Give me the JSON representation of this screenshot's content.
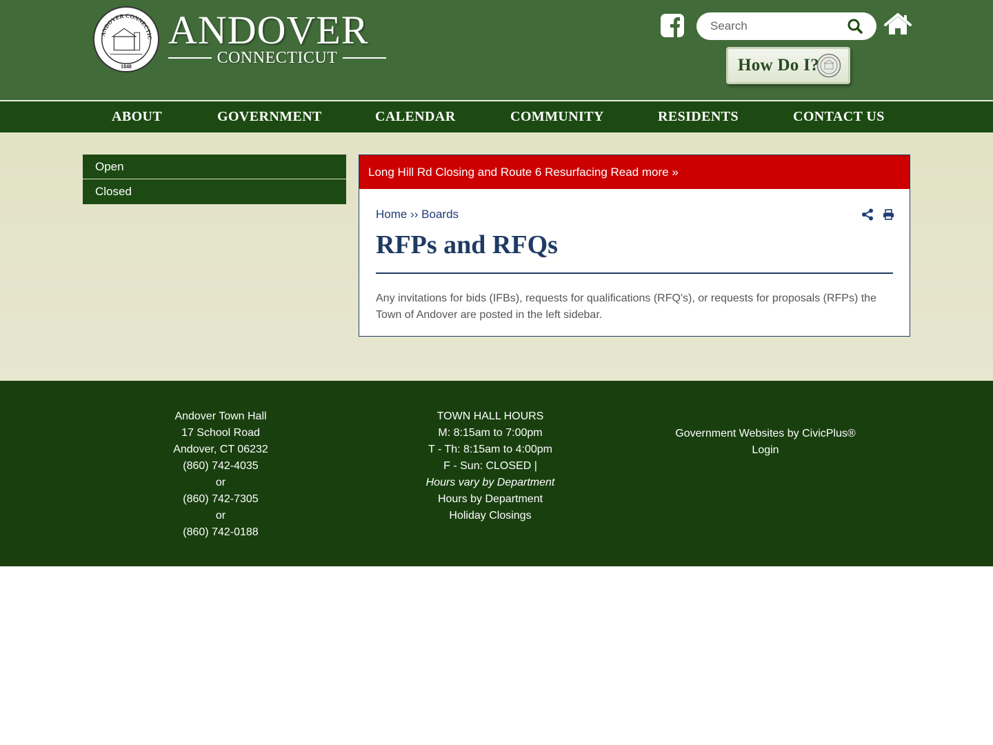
{
  "header": {
    "site_title": "ANDOVER",
    "site_subtitle": "CONNECTICUT",
    "search_placeholder": "Search",
    "how_do_i_label": "How Do I?"
  },
  "nav": {
    "items": [
      "ABOUT",
      "GOVERNMENT",
      "CALENDAR",
      "COMMUNITY",
      "RESIDENTS",
      "CONTACT US"
    ]
  },
  "sidebar": {
    "items": [
      "Open",
      "Closed"
    ]
  },
  "alert": {
    "text": "Long Hill Rd Closing and Route 6 Resurfacing Read more »"
  },
  "breadcrumb": {
    "home": "Home",
    "separator": "››",
    "current": "Boards"
  },
  "page": {
    "title": "RFPs and RFQs",
    "body": "Any invitations for bids (IFBs), requests for qualifications (RFQ's), or requests for proposals (RFPs) the Town of Andover are posted in the left sidebar."
  },
  "footer": {
    "address": {
      "name": "Andover Town Hall",
      "street": "17 School Road",
      "city": "Andover, CT 06232",
      "phone1": "(860) 742-4035",
      "or1": "or",
      "phone2": "(860) 742-7305",
      "or2": "or",
      "phone3": "(860) 742-0188"
    },
    "hours": {
      "heading": "TOWN HALL HOURS",
      "line1": "M: 8:15am to 7:00pm",
      "line2": "T - Th: 8:15am to 4:00pm",
      "line3": "F - Sun: CLOSED |",
      "line4": "Hours vary by Department",
      "link1": "Hours by Department",
      "link2": "Holiday Closings"
    },
    "credits": {
      "civicplus": "Government Websites by CivicPlus®",
      "login": "Login"
    }
  },
  "colors": {
    "header_green": "#416b39",
    "nav_green": "#1c4a12",
    "footer_green": "#193f0f",
    "alert_red": "#cc0000",
    "title_navy": "#1f3b63"
  },
  "icons": [
    "seal-logo",
    "facebook-icon",
    "search-icon",
    "home-icon",
    "share-icon",
    "print-icon"
  ]
}
